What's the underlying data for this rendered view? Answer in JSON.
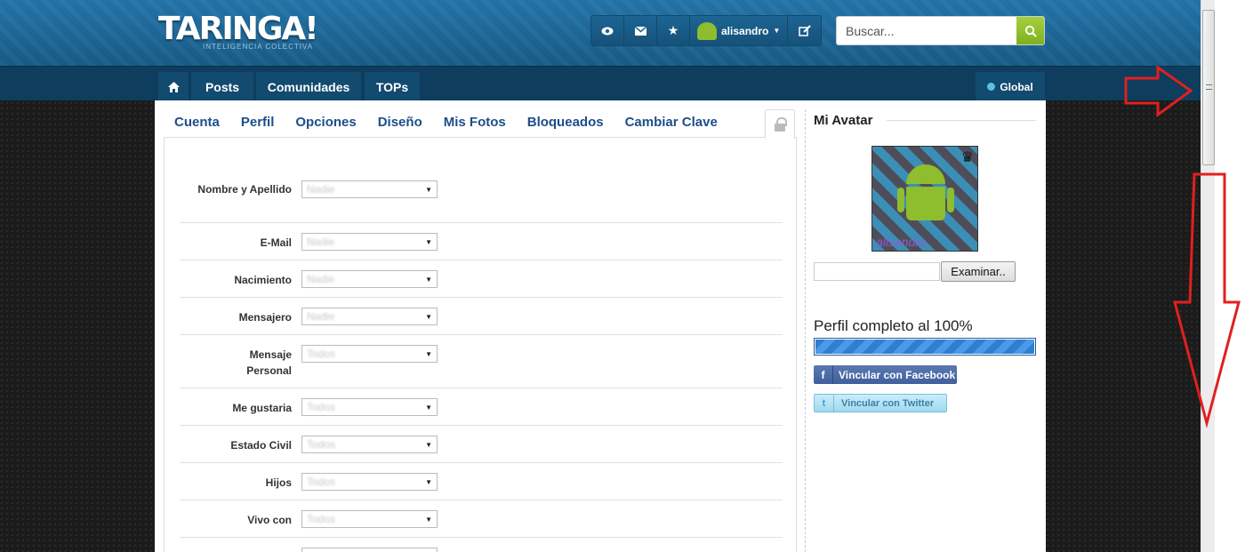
{
  "header": {
    "logo": "TARINGA!",
    "logo_sub": "INTELIGENCIA COLECTIVA",
    "user_name": "alisandro",
    "icons": [
      "eye-icon",
      "mail-icon",
      "star-icon",
      "edit-icon"
    ],
    "search": {
      "placeholder": "Buscar..."
    }
  },
  "nav": {
    "items": [
      "Posts",
      "Comunidades",
      "TOPs"
    ],
    "global_label": "Global"
  },
  "tabs": [
    "Cuenta",
    "Perfil",
    "Opciones",
    "Diseño",
    "Mis Fotos",
    "Bloqueados",
    "Cambiar Clave"
  ],
  "form": {
    "rows": [
      {
        "label": "Nombre y Apellido",
        "value": "Nadie"
      },
      {
        "label": "E-Mail",
        "value": "Nadie"
      },
      {
        "label": "Nacimiento",
        "value": "Nadie"
      },
      {
        "label": "Mensajero",
        "value": "Nadie"
      },
      {
        "label": "Mensaje Personal",
        "value": "Todos"
      },
      {
        "label": "Me gustaria",
        "value": "Todos"
      },
      {
        "label": "Estado Civil",
        "value": "Todos"
      },
      {
        "label": "Hijos",
        "value": "Todos"
      },
      {
        "label": "Vivo con",
        "value": "Todos"
      }
    ]
  },
  "sidebar": {
    "title": "Mi Avatar",
    "avatar_caption": "alisandro",
    "browse_button": "Examinar..",
    "profile_complete": "Perfil completo al 100%",
    "profile_progress": 1.0,
    "facebook_button": "Vincular con Facebook",
    "twitter_button": "Vincular con Twitter"
  },
  "colors": {
    "header_blue": "#1d6593",
    "nav_dark": "#0e3d5d",
    "tab_link": "#1d4e8a",
    "search_green": "#8ebd2e",
    "annotation_red": "#e02020"
  }
}
